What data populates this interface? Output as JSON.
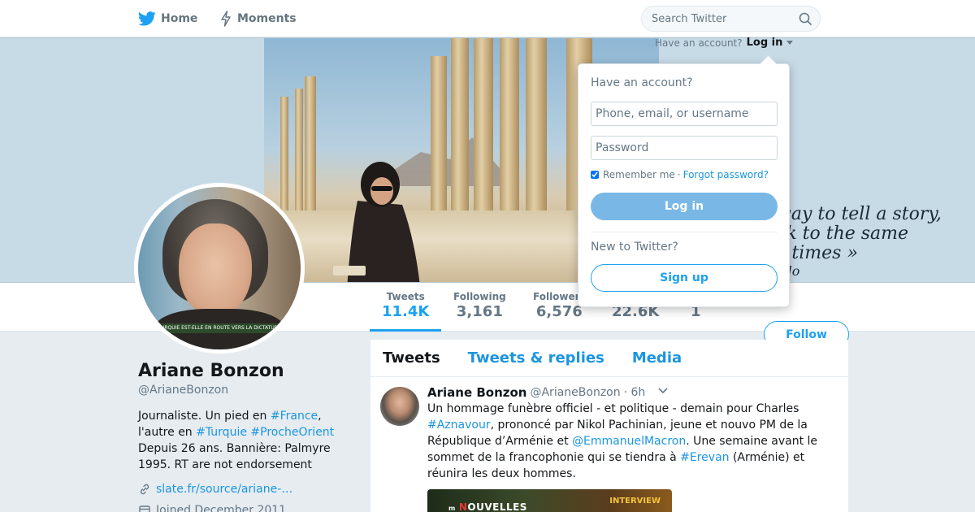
{
  "nav": {
    "home_label": "Home",
    "moments_label": "Moments",
    "search_placeholder": "Search Twitter"
  },
  "banner": {
    "quote_lines": [
      "way to tell a story,",
      "ck to the same",
      "y times »",
      "ado"
    ]
  },
  "avatar": {
    "ticker_text": "TURQUIE EST-ELLE EN ROUTE VERS LA DICTATURE"
  },
  "stats": [
    {
      "label": "Tweets",
      "value": "11.4K"
    },
    {
      "label": "Following",
      "value": "3,161"
    },
    {
      "label": "Followers",
      "value": "6,576"
    },
    {
      "label": "",
      "value": "22.6K"
    },
    {
      "label": "",
      "value": "1"
    }
  ],
  "profile": {
    "name": "Ariane Bonzon",
    "handle": "@ArianeBonzon",
    "bio": {
      "p1": "Journaliste. Un pied en ",
      "t1": "#France",
      "p2": ", l'autre en ",
      "t2": "#Turquie",
      "p3": " ",
      "t3": "#ProcheOrient",
      "p4": " Depuis 26 ans. Bannière: Palmyre 1995. RT are not endorsement"
    },
    "link": "slate.fr/source/ariane-…",
    "joined": "Joined December 2011",
    "follow_label": "Follow"
  },
  "timeline": {
    "tabs": [
      "Tweets",
      "Tweets & replies",
      "Media"
    ]
  },
  "tweet": {
    "name": "Ariane Bonzon",
    "handle": "@ArianeBonzon",
    "time": "· 6h",
    "text": {
      "s1": "Un hommage funèbre officiel - et politique - demain pour Charles ",
      "t1": "#Aznavour",
      "s2": ", prononcé par Nikol Pachinian, jeune et nouvo PM de la République d’Arménie et ",
      "t2": "@EmmanuelMacron",
      "s3": ". Une semaine avant le sommet de la francophonie qui se tiendra à ",
      "t3": "#Erevan",
      "s4": " (Arménie) et réunira les deux hommes."
    },
    "media_brand_n": "N",
    "media_brand_rest": "OUVELLES",
    "media_brand_prefix": "m",
    "media_badge": "INTERVIEW"
  },
  "login": {
    "trigger_text": "Have an account?",
    "trigger_link": "Log in",
    "title": "Have an account?",
    "user_placeholder": "Phone, email, or username",
    "pass_placeholder": "Password",
    "remember": "Remember me",
    "sep": "·",
    "forgot": "Forgot password?",
    "login_button": "Log in",
    "new_text": "New to Twitter?",
    "signup_button": "Sign up"
  },
  "colors": {
    "accent": "#1da1f2",
    "link": "#1b95e0",
    "background": "#e6ecf0"
  }
}
